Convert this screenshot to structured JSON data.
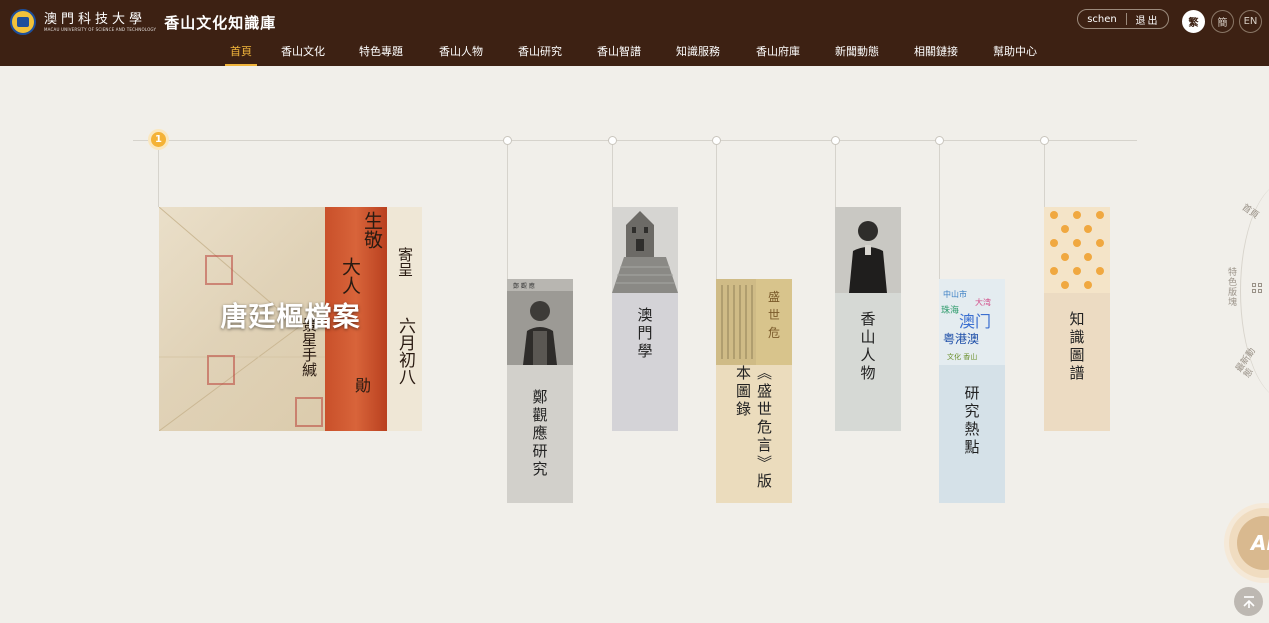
{
  "header": {
    "university_cn": "澳門科技大學",
    "university_en": "MACAU UNIVERSITY OF SCIENCE AND TECHNOLOGY",
    "site_title": "香山文化知識庫",
    "user": {
      "name": "schen",
      "logout": "退出"
    },
    "languages": [
      "繁",
      "簡",
      "EN"
    ]
  },
  "nav": {
    "items": [
      "首頁",
      "香山文化",
      "特色專題",
      "香山人物",
      "香山研究",
      "香山智譜",
      "知識服務",
      "香山府庫",
      "新聞動態",
      "相關鏈接",
      "幫助中心"
    ],
    "active_index": 0
  },
  "timeline": {
    "current_number": "1"
  },
  "featured": {
    "title": "唐廷樞檔案",
    "calligraphy": [
      "寄呈",
      "生敬",
      "大人",
      "景星手緘",
      "六月初八",
      "勛"
    ]
  },
  "cards": [
    {
      "label": "鄭觀應研究",
      "image": "portrait-photo",
      "color": "#d2d0cb"
    },
    {
      "label": "澳門學",
      "image": "ruins-of-st-paul-photo",
      "color": "#d4d3d7"
    },
    {
      "label": "《盛世危言》版本圖錄",
      "image": "book-page-photo",
      "color": "#ebdcbd"
    },
    {
      "label": "香山人物",
      "image": "sun-yat-sen-photo",
      "color": "#d6d9d5"
    },
    {
      "label": "研究熱點",
      "image": "word-cloud",
      "color": "#d5e1e8"
    },
    {
      "label": "知識圖譜",
      "image": "orange-dot-pattern",
      "color": "#ecdbc2"
    }
  ],
  "side_menu": {
    "items": [
      "首頁",
      "特色版塊",
      "最新動態"
    ],
    "icon": "grid-icon"
  },
  "ai_button": {
    "label": "AI"
  },
  "back_to_top": {
    "icon": "arrow-up-icon"
  }
}
